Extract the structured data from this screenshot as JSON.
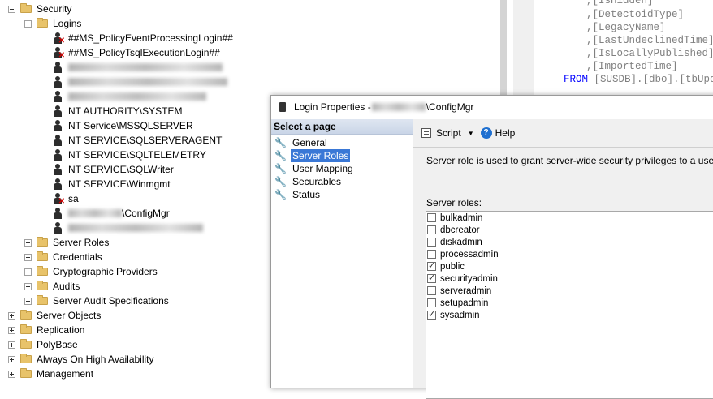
{
  "tree": {
    "security": "Security",
    "logins": "Logins",
    "login_items": [
      "##MS_PolicyEventProcessingLogin##",
      "##MS_PolicyTsqlExecutionLogin##",
      "NT AUTHORITY\\SYSTEM",
      "NT Service\\MSSQLSERVER",
      "NT SERVICE\\SQLSERVERAGENT",
      "NT SERVICE\\SQLTELEMETRY",
      "NT SERVICE\\SQLWriter",
      "NT SERVICE\\Winmgmt",
      "sa",
      "\\ConfigMgr"
    ],
    "security_children": [
      "Server Roles",
      "Credentials",
      "Cryptographic Providers",
      "Audits",
      "Server Audit Specifications"
    ],
    "top_level": [
      "Server Objects",
      "Replication",
      "PolyBase",
      "Always On High Availability",
      "Management"
    ]
  },
  "code": {
    "lines": [
      ",[IsHidden]",
      ",[DetectoidType]",
      ",[LegacyName]",
      ",[LastUndeclinedTime]",
      ",[IsLocallyPublished]",
      ",[ImportedTime]"
    ],
    "from_kw": "FROM",
    "from_rest": "[SUSDB].[dbo].[tbUpda"
  },
  "dialog": {
    "title_prefix": "Login Properties - ",
    "title_suffix": "\\ConfigMgr",
    "select_page": "Select a page",
    "pages": [
      "General",
      "Server Roles",
      "User Mapping",
      "Securables",
      "Status"
    ],
    "script": "Script",
    "help": "Help",
    "description": "Server role is used to grant server-wide security privileges to a user.",
    "roles_label": "Server roles:",
    "roles": [
      {
        "name": "bulkadmin",
        "checked": false
      },
      {
        "name": "dbcreator",
        "checked": false
      },
      {
        "name": "diskadmin",
        "checked": false
      },
      {
        "name": "processadmin",
        "checked": false
      },
      {
        "name": "public",
        "checked": true
      },
      {
        "name": "securityadmin",
        "checked": true
      },
      {
        "name": "serveradmin",
        "checked": false
      },
      {
        "name": "setupadmin",
        "checked": false
      },
      {
        "name": "sysadmin",
        "checked": true
      }
    ]
  }
}
